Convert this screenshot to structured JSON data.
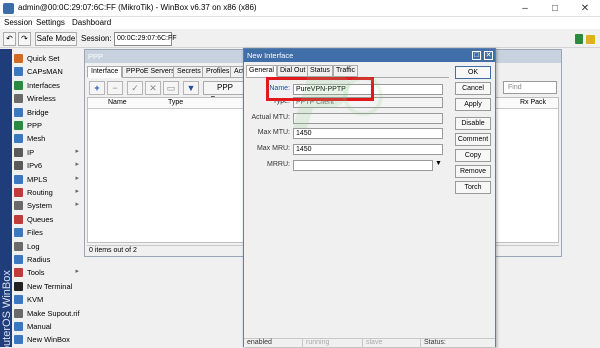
{
  "window": {
    "title": "admin@00:0C:29:07:6C:FF (MikroTik) - WinBox v6.37 on x86 (x86)",
    "controls": [
      "–",
      "□",
      "✕"
    ]
  },
  "menu": {
    "session": "Session",
    "settings": "Settings",
    "dashboard": "Dashboard"
  },
  "toolbar": {
    "undo": "↶",
    "redo": "↷",
    "safe_mode": "Safe Mode",
    "session_label": "Session:",
    "session_value": "00:0C:29:07:6C:FF"
  },
  "sidebar": {
    "brand": "RouterOS WinBox",
    "items": [
      {
        "label": "Quick Set",
        "icon": "quick-set-icon",
        "color": "#d46a1f",
        "arrow": ""
      },
      {
        "label": "CAPsMAN",
        "icon": "capsman-icon",
        "color": "#3a78c2",
        "arrow": ""
      },
      {
        "label": "Interfaces",
        "icon": "interfaces-icon",
        "color": "#2a8a3e",
        "arrow": ""
      },
      {
        "label": "Wireless",
        "icon": "wireless-icon",
        "color": "#6a6a6a",
        "arrow": ""
      },
      {
        "label": "Bridge",
        "icon": "bridge-icon",
        "color": "#3a78c2",
        "arrow": ""
      },
      {
        "label": "PPP",
        "icon": "ppp-icon",
        "color": "#2a8a3e",
        "arrow": ""
      },
      {
        "label": "Mesh",
        "icon": "mesh-icon",
        "color": "#3a78c2",
        "arrow": ""
      },
      {
        "label": "IP",
        "icon": "ip-icon",
        "color": "#5a5a5a",
        "arrow": "▸"
      },
      {
        "label": "IPv6",
        "icon": "ipv6-icon",
        "color": "#5a5a5a",
        "arrow": "▸"
      },
      {
        "label": "MPLS",
        "icon": "mpls-icon",
        "color": "#3a78c2",
        "arrow": "▸"
      },
      {
        "label": "Routing",
        "icon": "routing-icon",
        "color": "#c23a3a",
        "arrow": "▸"
      },
      {
        "label": "System",
        "icon": "system-icon",
        "color": "#6a6a6a",
        "arrow": "▸"
      },
      {
        "label": "Queues",
        "icon": "queues-icon",
        "color": "#c23a3a",
        "arrow": ""
      },
      {
        "label": "Files",
        "icon": "files-icon",
        "color": "#3a78c2",
        "arrow": ""
      },
      {
        "label": "Log",
        "icon": "log-icon",
        "color": "#6a6a6a",
        "arrow": ""
      },
      {
        "label": "Radius",
        "icon": "radius-icon",
        "color": "#3a78c2",
        "arrow": ""
      },
      {
        "label": "Tools",
        "icon": "tools-icon",
        "color": "#c23a3a",
        "arrow": "▸"
      },
      {
        "label": "New Terminal",
        "icon": "terminal-icon",
        "color": "#222222",
        "arrow": ""
      },
      {
        "label": "KVM",
        "icon": "kvm-icon",
        "color": "#3a78c2",
        "arrow": ""
      },
      {
        "label": "Make Supout.rif",
        "icon": "supout-icon",
        "color": "#6a6a6a",
        "arrow": ""
      },
      {
        "label": "Manual",
        "icon": "manual-icon",
        "color": "#3a78c2",
        "arrow": ""
      },
      {
        "label": "New WinBox",
        "icon": "winbox-icon",
        "color": "#3a78c2",
        "arrow": ""
      }
    ]
  },
  "ppp": {
    "title": "PPP",
    "tabs": [
      "Interface",
      "PPPoE Servers",
      "Secrets",
      "Profiles",
      "Act"
    ],
    "scanner_label": "PPP Scanner",
    "find_placeholder": "Find",
    "columns": [
      "Name",
      "Type",
      "Rx Pack"
    ],
    "status": "0 items out of 2"
  },
  "dialog": {
    "title": "New Interface",
    "tabs": [
      "General",
      "Dial Out",
      "Status",
      "Traffic"
    ],
    "fields": {
      "name_label": "Name:",
      "name_value": "PureVPN-PPTP",
      "type_label": "Type:",
      "type_value": "PPTP Client",
      "actual_mtu_label": "Actual MTU:",
      "actual_mtu_value": "",
      "max_mtu_label": "Max MTU:",
      "max_mtu_value": "1450",
      "max_mru_label": "Max MRU:",
      "max_mru_value": "1450",
      "mrru_label": "MRRU:",
      "mrru_value": ""
    },
    "buttons": [
      "OK",
      "Cancel",
      "Apply",
      "Disable",
      "Comment",
      "Copy",
      "Remove",
      "Torch"
    ],
    "status": {
      "state": "enabled",
      "running": "running",
      "slave": "slave",
      "status_label": "Status:"
    }
  },
  "colors": {
    "highlight": "#e0191f",
    "dialog_title": "#3f6ea8",
    "sidebar_strip": "#1f3d7a"
  }
}
